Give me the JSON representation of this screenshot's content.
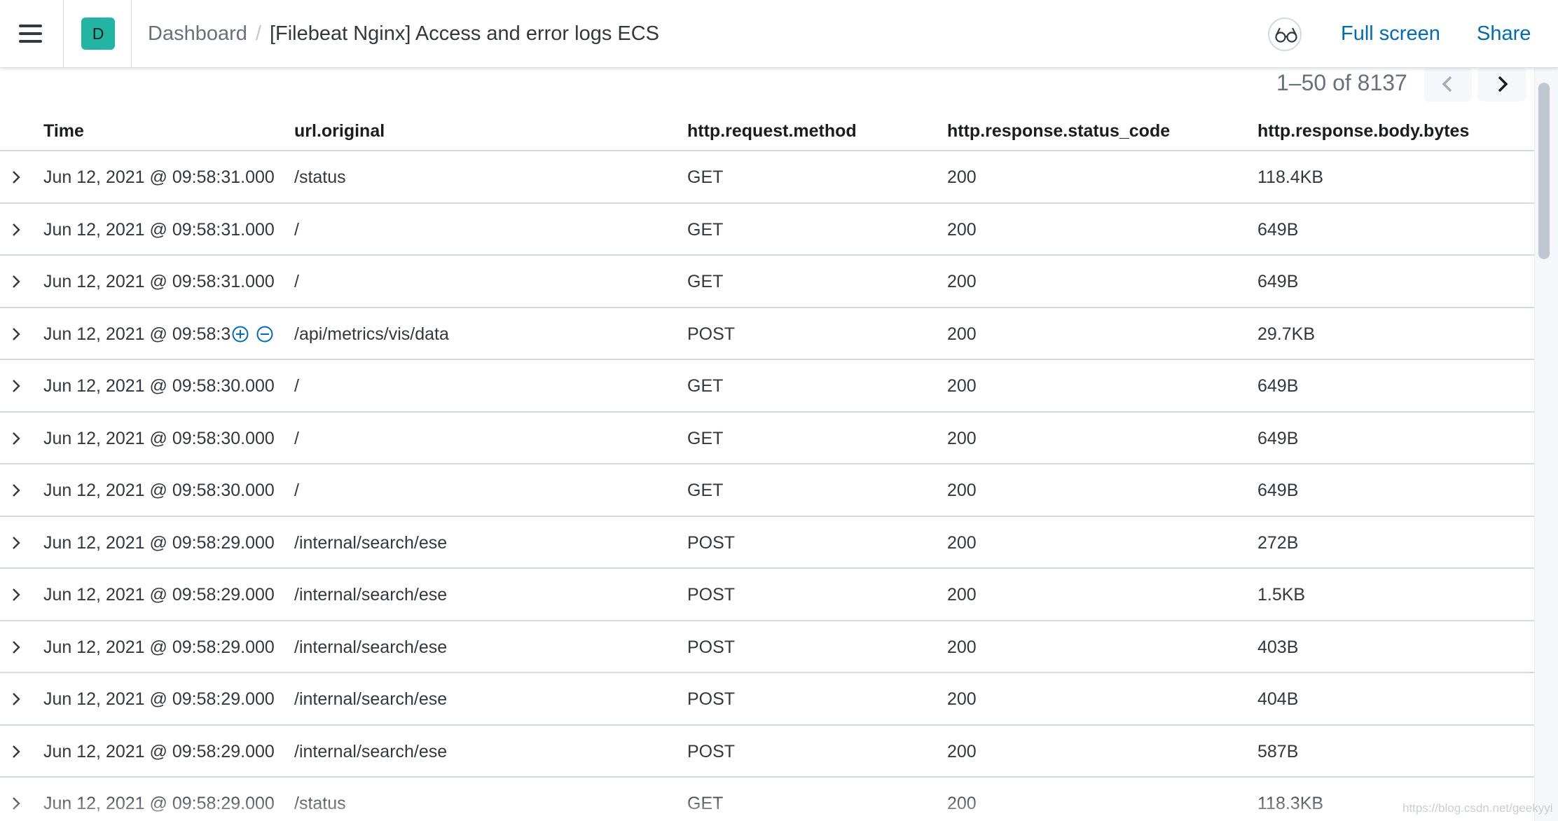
{
  "header": {
    "avatar_letter": "D",
    "breadcrumb_parent": "Dashboard",
    "breadcrumb_separator": "/",
    "breadcrumb_current": "[Filebeat Nginx] Access and error logs ECS",
    "full_screen_label": "Full screen",
    "share_label": "Share",
    "icons": [
      "menu-icon",
      "glasses-icon"
    ]
  },
  "pagination": {
    "text": "1–50 of 8137"
  },
  "table": {
    "columns": [
      "Time",
      "url.original",
      "http.request.method",
      "http.response.status_code",
      "http.response.body.bytes"
    ],
    "rows": [
      [
        "Jun 12, 2021 @ 09:58:31.000",
        "/status",
        "GET",
        "200",
        "118.4KB"
      ],
      [
        "Jun 12, 2021 @ 09:58:31.000",
        "/",
        "GET",
        "200",
        "649B"
      ],
      [
        "Jun 12, 2021 @ 09:58:31.000",
        "/",
        "GET",
        "200",
        "649B"
      ],
      [
        "Jun 12, 2021 @ 09:58:3",
        "/api/metrics/vis/data",
        "POST",
        "200",
        "29.7KB"
      ],
      [
        "Jun 12, 2021 @ 09:58:30.000",
        "/",
        "GET",
        "200",
        "649B"
      ],
      [
        "Jun 12, 2021 @ 09:58:30.000",
        "/",
        "GET",
        "200",
        "649B"
      ],
      [
        "Jun 12, 2021 @ 09:58:30.000",
        "/",
        "GET",
        "200",
        "649B"
      ],
      [
        "Jun 12, 2021 @ 09:58:29.000",
        "/internal/search/ese",
        "POST",
        "200",
        "272B"
      ],
      [
        "Jun 12, 2021 @ 09:58:29.000",
        "/internal/search/ese",
        "POST",
        "200",
        "1.5KB"
      ],
      [
        "Jun 12, 2021 @ 09:58:29.000",
        "/internal/search/ese",
        "POST",
        "200",
        "403B"
      ],
      [
        "Jun 12, 2021 @ 09:58:29.000",
        "/internal/search/ese",
        "POST",
        "200",
        "404B"
      ],
      [
        "Jun 12, 2021 @ 09:58:29.000",
        "/internal/search/ese",
        "POST",
        "200",
        "587B"
      ],
      [
        "Jun 12, 2021 @ 09:58:29.000",
        "/status",
        "GET",
        "200",
        "118.3KB"
      ]
    ],
    "hovered_row_index": 3,
    "hover_icons": [
      "filter-for-value-icon",
      "filter-out-value-icon"
    ]
  },
  "watermark": "https://blog.csdn.net/geekyyi",
  "colors": {
    "link": "#006bb8",
    "avatar": "#22b5a3",
    "border": "#d3dae6"
  }
}
